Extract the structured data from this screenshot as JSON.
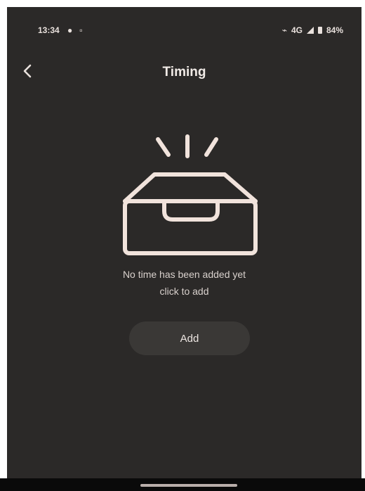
{
  "status_bar": {
    "time": "13:34",
    "network": "4G",
    "battery": "84%"
  },
  "header": {
    "title": "Timing",
    "back_icon": "chevron-left-icon"
  },
  "empty_state": {
    "icon": "empty-inbox-icon",
    "line1": "No time has been added yet",
    "line2": "click to add"
  },
  "actions": {
    "add_label": "Add"
  },
  "colors": {
    "background": "#2b2928",
    "illustration_stroke": "#f1e3dc",
    "button_bg": "#3a3836",
    "text": "#d9d1cd"
  }
}
